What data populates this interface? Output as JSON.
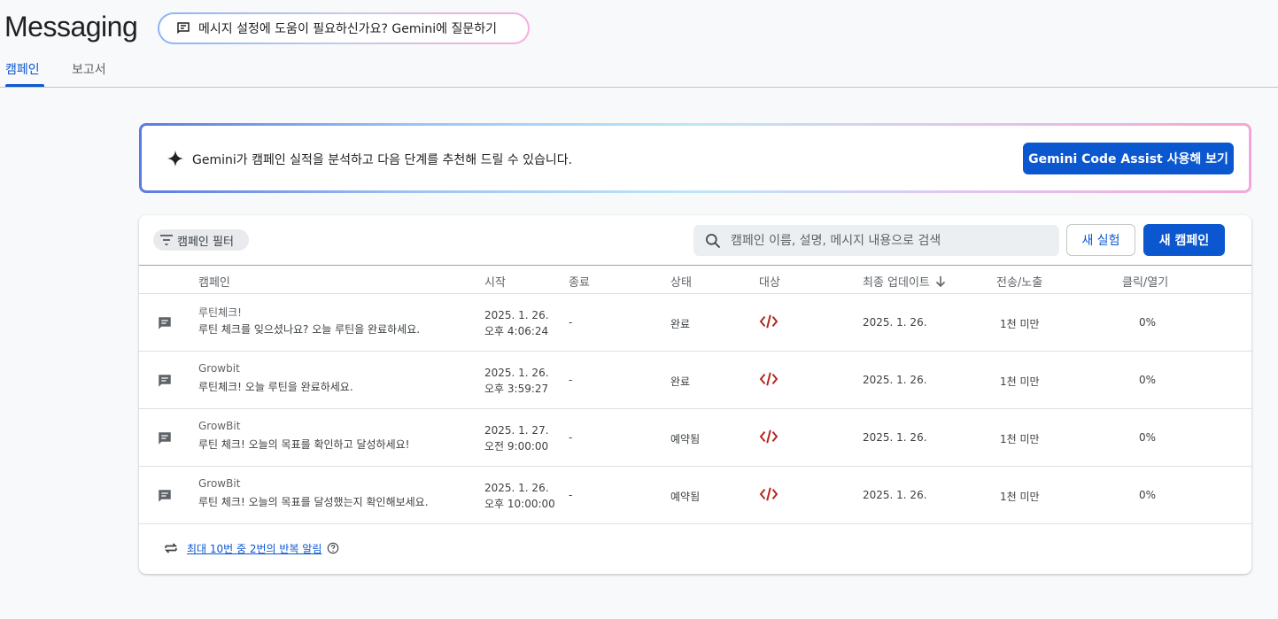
{
  "header": {
    "title": "Messaging",
    "ask_gemini": "메시지 설정에 도움이 필요하신가요? Gemini에 질문하기"
  },
  "tabs": [
    {
      "label": "캠페인",
      "active": true
    },
    {
      "label": "보고서",
      "active": false
    }
  ],
  "banner": {
    "text": "Gemini가 캠페인 실적을 분석하고 다음 단계를 추천해 드릴 수 있습니다.",
    "button": "Gemini Code Assist 사용해 보기"
  },
  "toolbar": {
    "filter": "캠페인 필터",
    "search_placeholder": "캠페인 이름, 설명, 메시지 내용으로 검색",
    "new_experiment": "새 실험",
    "new_campaign": "새 캠페인"
  },
  "table": {
    "columns": [
      "캠페인",
      "시작",
      "종료",
      "상태",
      "대상",
      "최종 업데이트",
      "전송/노출",
      "클릭/열기"
    ],
    "rows": [
      {
        "name": "루틴체크!",
        "desc": "루틴 체크를 잊으셨나요? 오늘 루틴을 완료하세요.",
        "start_date": "2025. 1. 26.",
        "start_time": "오후 4:06:24",
        "end": "-",
        "status": "완료",
        "updated": "2025. 1. 26.",
        "sends": "1천 미만",
        "clicks": "0%"
      },
      {
        "name": "Growbit",
        "desc": "루틴체크! 오늘 루틴을 완료하세요.",
        "start_date": "2025. 1. 26.",
        "start_time": "오후 3:59:27",
        "end": "-",
        "status": "완료",
        "updated": "2025. 1. 26.",
        "sends": "1천 미만",
        "clicks": "0%"
      },
      {
        "name": "GrowBit",
        "desc": "루틴 체크! 오늘의 목표를 확인하고 달성하세요!",
        "start_date": "2025. 1. 27.",
        "start_time": "오전 9:00:00",
        "end": "-",
        "status": "예약됨",
        "updated": "2025. 1. 26.",
        "sends": "1천 미만",
        "clicks": "0%"
      },
      {
        "name": "GrowBit",
        "desc": "루틴 체크! 오늘의 목표를 달성했는지 확인해보세요.",
        "start_date": "2025. 1. 26.",
        "start_time": "오후 10:00:00",
        "end": "-",
        "status": "예약됨",
        "updated": "2025. 1. 26.",
        "sends": "1천 미만",
        "clicks": "0%"
      }
    ]
  },
  "footer": {
    "link": "최대 10번 중 2번의 반복 알림"
  },
  "colors": {
    "accent": "#0b57d0",
    "code_icon": "#b3261e"
  }
}
